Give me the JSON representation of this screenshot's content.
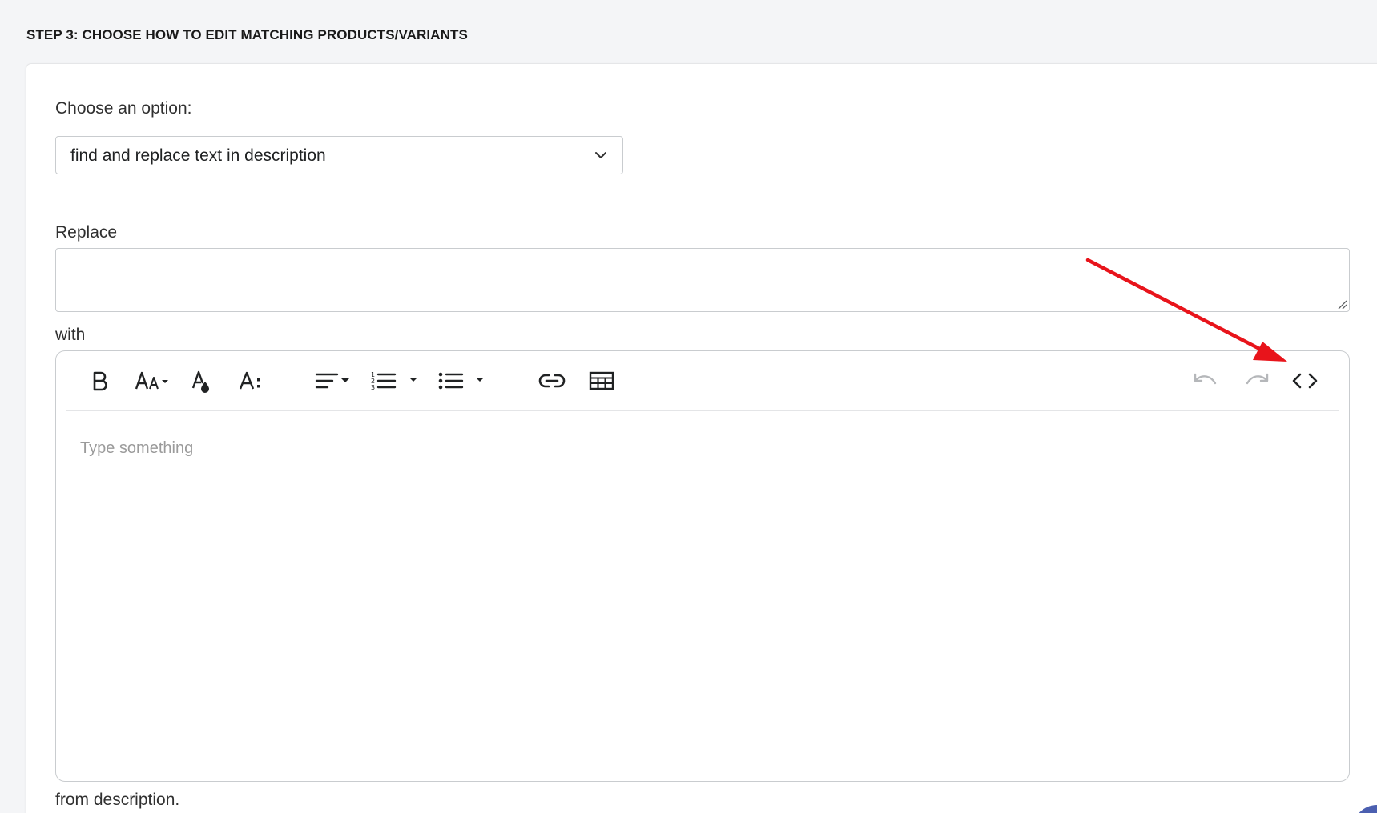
{
  "header": {
    "step_title": "STEP 3: CHOOSE HOW TO EDIT MATCHING PRODUCTS/VARIANTS"
  },
  "form": {
    "choose_label": "Choose an option:",
    "option_selected": "find and replace text in description",
    "replace_label": "Replace",
    "replace_value": "",
    "with_label": "with",
    "editor_placeholder": "Type something",
    "footer_text": "from description."
  },
  "toolbar": {
    "icons": [
      "bold-icon",
      "font-size-icon",
      "text-color-icon",
      "text-style-icon",
      "align-icon",
      "ordered-list-icon",
      "unordered-list-icon",
      "link-icon",
      "table-icon",
      "undo-icon",
      "redo-icon",
      "code-view-icon"
    ]
  },
  "colors": {
    "annotation_arrow": "#e8141b",
    "border": "#c9cccf",
    "placeholder": "#9b9b9b"
  }
}
